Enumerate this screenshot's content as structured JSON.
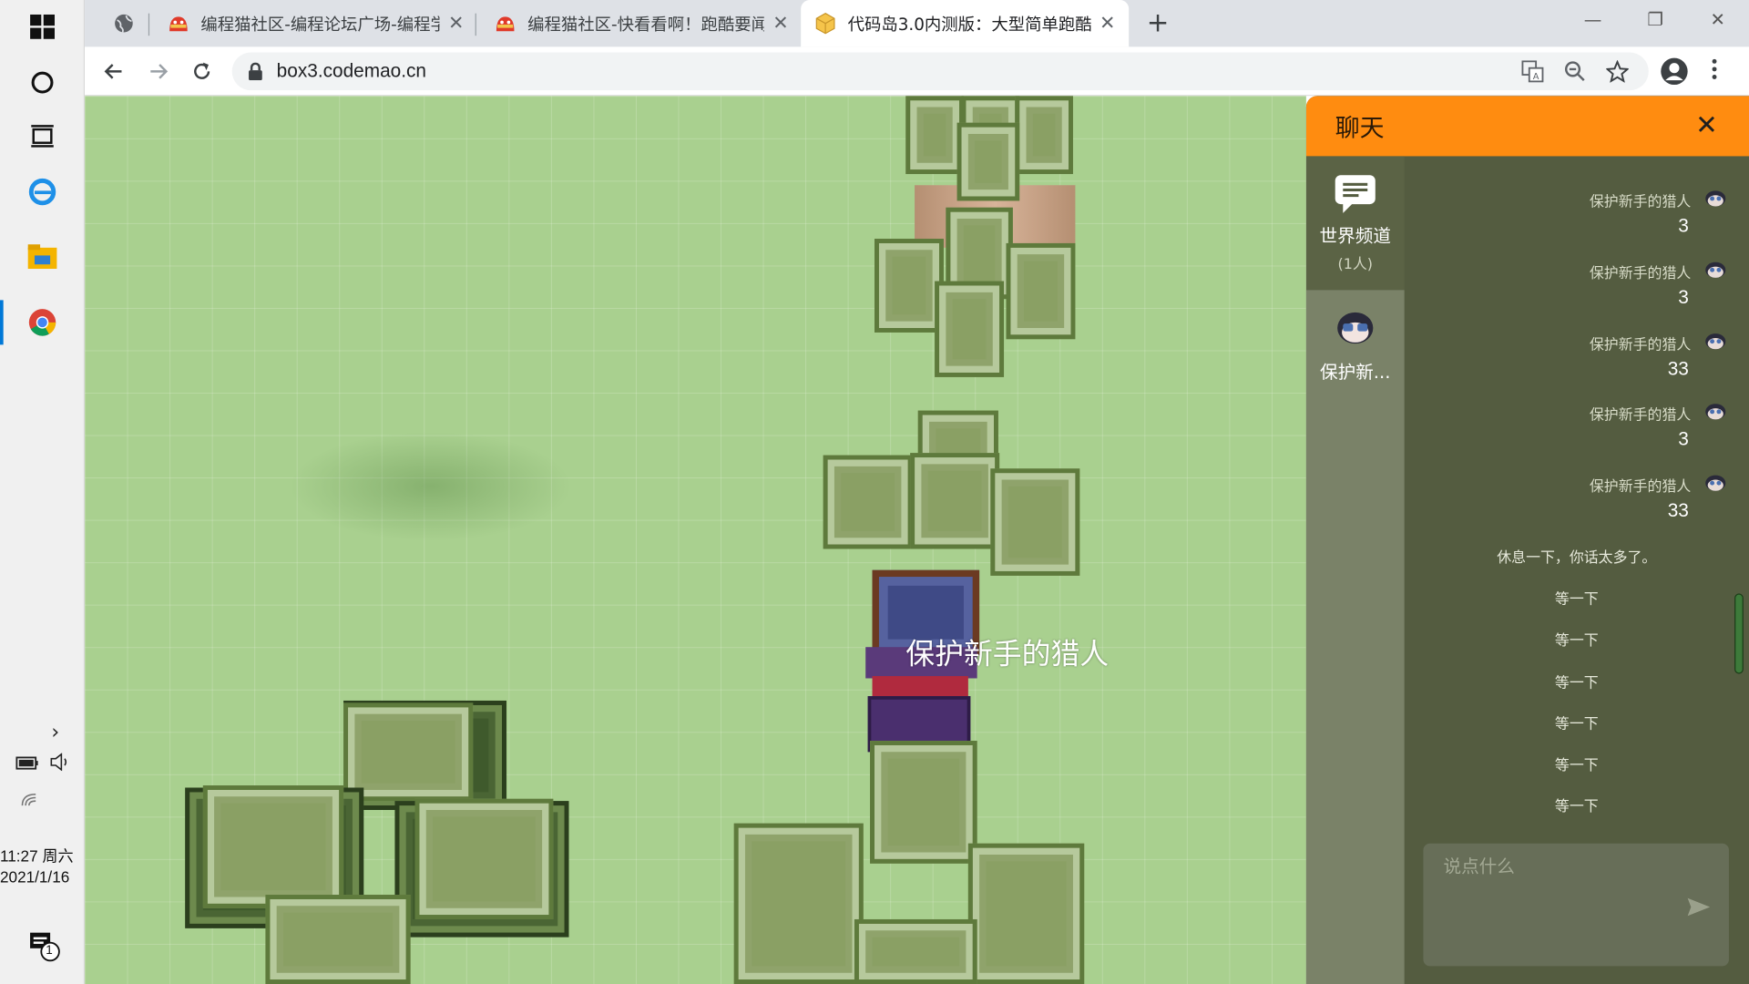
{
  "taskbar": {
    "icons": [
      "windows-start-icon",
      "cortana-icon",
      "task-view-icon",
      "ie-icon",
      "file-explorer-icon",
      "chrome-icon"
    ],
    "time": "11:27 周六",
    "date": "2021/1/16",
    "notification_count": "1"
  },
  "browser": {
    "tabs": [
      {
        "title": "",
        "icon": "globe-icon"
      },
      {
        "title": "编程猫社区-编程论坛广场-编程学",
        "icon": "codemao-icon"
      },
      {
        "title": "编程猫社区-快看看啊！跑酷要闻",
        "icon": "codemao-icon"
      },
      {
        "title": "代码岛3.0内测版：大型简单跑酷",
        "icon": "box3-icon",
        "active": true
      }
    ],
    "url": "box3.codemao.cn"
  },
  "game": {
    "player_name": "保护新手的猎人"
  },
  "chat": {
    "title": "聊天",
    "channels": [
      {
        "label": "世界频道",
        "count": "(1人)",
        "icon": "chat-bubble-icon"
      },
      {
        "label": "保护新...",
        "icon": "avatar-icon"
      }
    ],
    "messages": [
      {
        "sender": "保护新手的猎人",
        "text": "3"
      },
      {
        "sender": "保护新手的猎人",
        "text": "3"
      },
      {
        "sender": "保护新手的猎人",
        "text": "33"
      },
      {
        "sender": "保护新手的猎人",
        "text": "3"
      },
      {
        "sender": "保护新手的猎人",
        "text": "33"
      }
    ],
    "system_messages": [
      "休息一下，你话太多了。",
      "等一下",
      "等一下",
      "等一下",
      "等一下",
      "等一下",
      "等一下"
    ],
    "input_placeholder": "说点什么"
  },
  "colors": {
    "chat_header": "#ff8c10",
    "chat_bg": "#545c40",
    "grass": "#a9d08f"
  }
}
